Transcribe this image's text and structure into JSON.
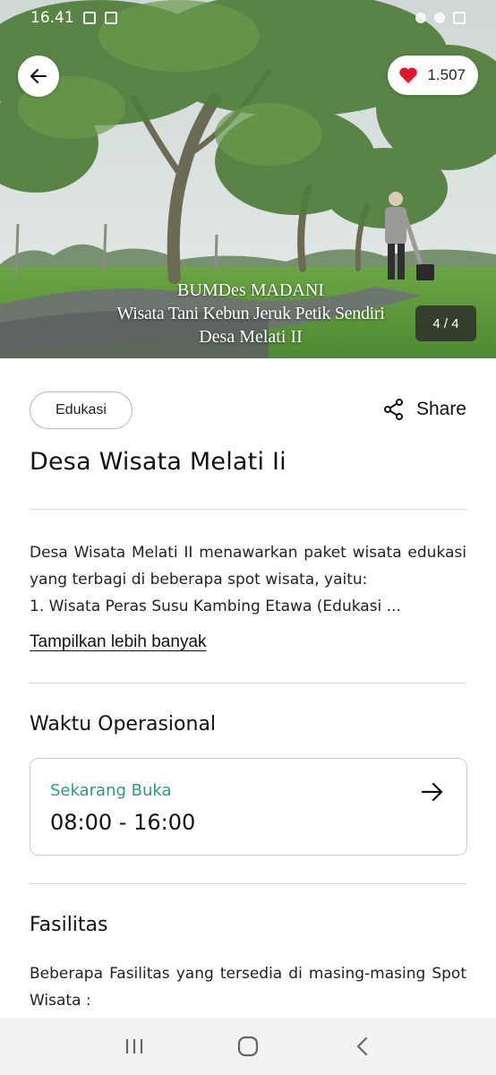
{
  "status_bar": {
    "time": "16.41"
  },
  "hero": {
    "like_count": "1.507",
    "caption_lines": [
      "BUMDes MADANI",
      "Wisata Tani Kebun Jeruk Petik Sendiri",
      "Desa Melati II"
    ],
    "image_counter": "4 / 4"
  },
  "detail": {
    "category": "Edukasi",
    "share_label": "Share",
    "title": "Desa Wisata Melati Ii",
    "description_lines": [
      "Desa Wisata Melati II menawarkan paket wisata edukasi yang terbagi di beberapa spot wisata, yaitu:",
      "1. Wisata Peras Susu Kambing Etawa (Edukasi ..."
    ],
    "show_more": "Tampilkan lebih banyak"
  },
  "operational": {
    "heading": "Waktu Operasional",
    "status": "Sekarang Buka",
    "hours": "08:00 - 16:00"
  },
  "facilities": {
    "heading": "Fasilitas",
    "text": "Beberapa Fasilitas yang tersedia di masing-masing Spot Wisata :"
  },
  "colors": {
    "accent_teal": "#2b9a86",
    "heart_red": "#e0182d"
  },
  "icons": [
    "back-arrow-icon",
    "heart-icon",
    "share-icon",
    "arrow-right-icon",
    "recent-apps-icon",
    "home-icon",
    "back-icon"
  ]
}
